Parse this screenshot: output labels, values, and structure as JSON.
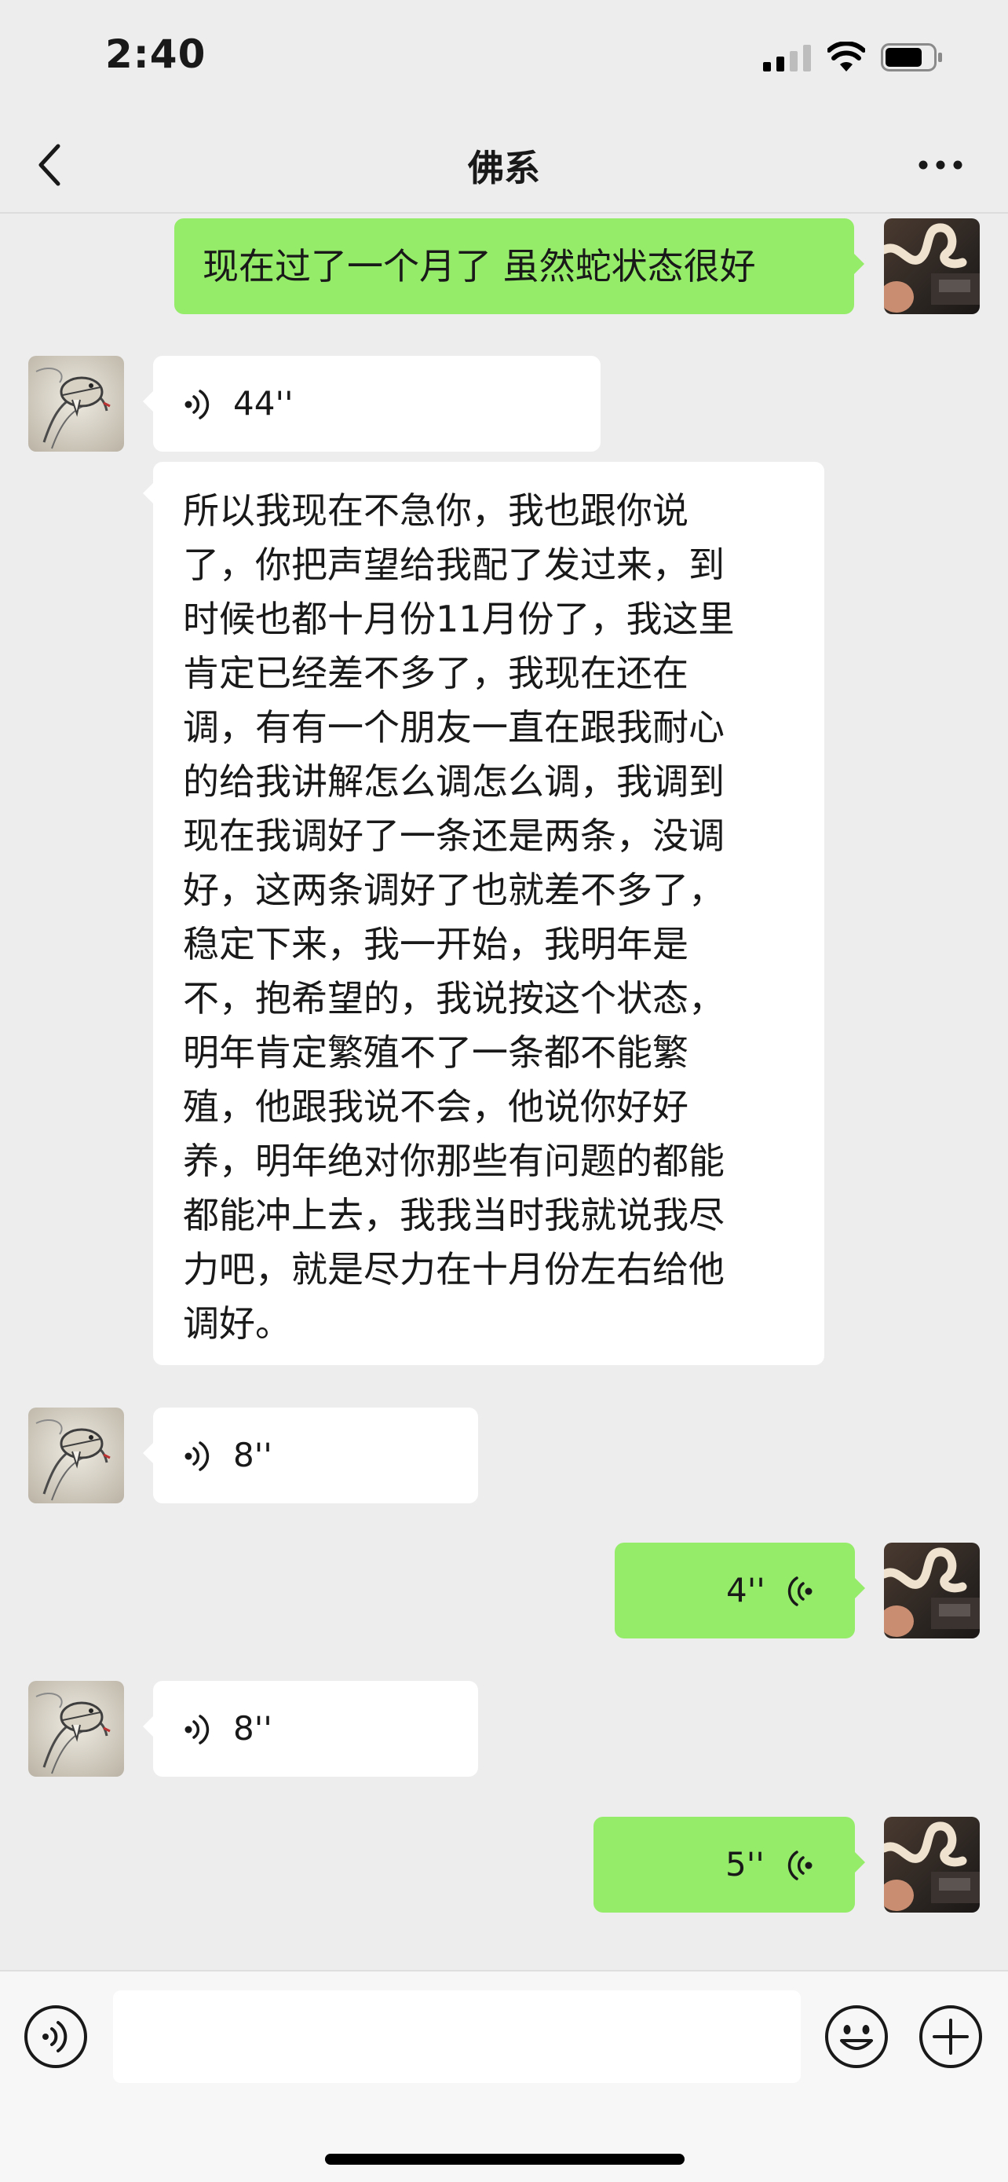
{
  "status_bar": {
    "time": "2:40"
  },
  "nav": {
    "title": "佛系"
  },
  "messages": [
    {
      "sender": "me",
      "type": "text",
      "text": "现在过了一个月了 虽然蛇状态很好"
    },
    {
      "sender": "contact",
      "type": "voice",
      "duration": "44''"
    },
    {
      "sender": "contact",
      "type": "text",
      "lines": [
        "所以我现在不急你，我也跟你说",
        "了，你把声望给我配了发过来，到",
        "时候也都十月份11月份了，我这里",
        "肯定已经差不多了，我现在还在",
        "调，有有一个朋友一直在跟我耐心",
        "的给我讲解怎么调怎么调，我调到",
        "现在我调好了一条还是两条，没调",
        "好，这两条调好了也就差不多了，",
        "稳定下来，我一开始，我明年是",
        "不，抱希望的，我说按这个状态，",
        "明年肯定繁殖不了一条都不能繁",
        "殖，他跟我说不会，他说你好好",
        "养，明年绝对你那些有问题的都能",
        "都能冲上去，我我当时我就说我尽",
        "力吧，就是尽力在十月份左右给他",
        "调好。"
      ]
    },
    {
      "sender": "contact",
      "type": "voice",
      "duration": "8''"
    },
    {
      "sender": "me",
      "type": "voice",
      "duration": "4''"
    },
    {
      "sender": "contact",
      "type": "voice",
      "duration": "8''"
    },
    {
      "sender": "me",
      "type": "voice",
      "duration": "5''"
    }
  ],
  "icons": {
    "back": "chevron-left-icon",
    "more": "more-dots-icon",
    "voice_mode": "voice-mode-icon",
    "emoji": "emoji-icon",
    "add": "plus-icon"
  },
  "colors": {
    "background": "#ededed",
    "sent_bubble": "#95ec69",
    "received_bubble": "#ffffff"
  }
}
